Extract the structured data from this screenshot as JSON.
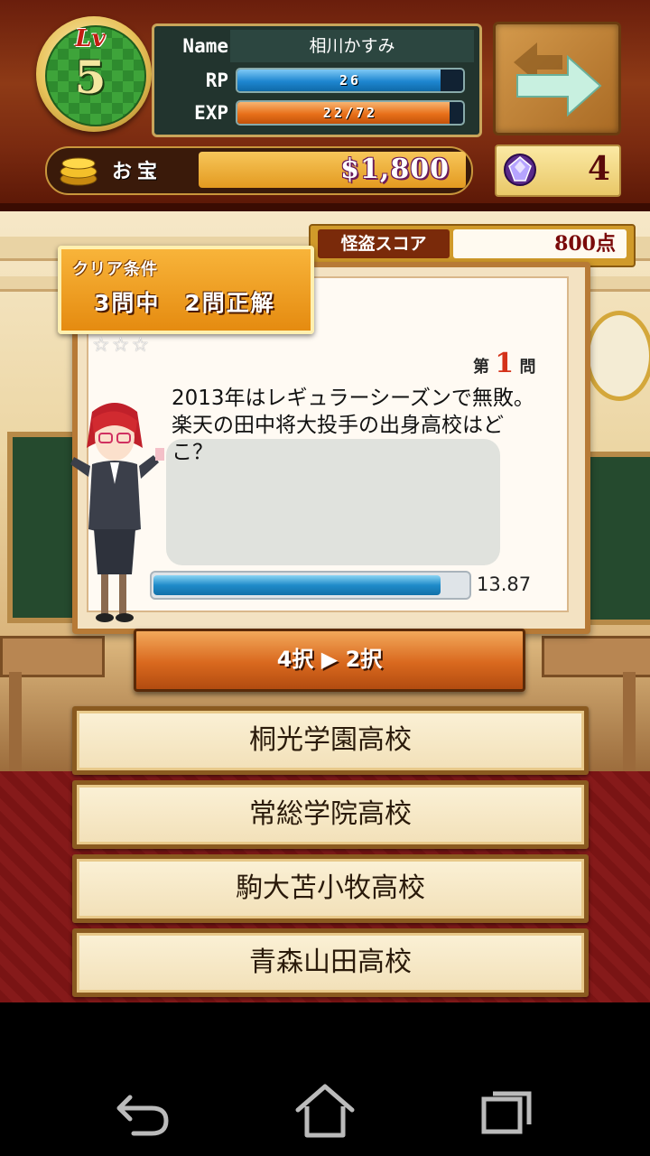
{
  "player": {
    "level_label": "Lv",
    "level": "5",
    "name_label": "Name",
    "name": "相川かすみ",
    "rp_label": "RP",
    "rp_value": "26",
    "rp_fill": 0.9,
    "exp_label": "EXP",
    "exp_value": "22/72",
    "exp_fill": 0.94
  },
  "treasure": {
    "label": "お宝",
    "value": "$1,800"
  },
  "gems": {
    "value": "4"
  },
  "score": {
    "label": "怪盗スコア",
    "value": "800点"
  },
  "clear_condition": {
    "title": "クリア条件",
    "text": "3問中　2問正解"
  },
  "question": {
    "stars": "☆☆☆",
    "round_prefix": "第",
    "round_number": "1",
    "round_suffix": "問",
    "text": "2013年はレギュラーシーズンで無敗。楽天の田中将大投手の出身高校はどこ？",
    "timer_value": "13.87",
    "timer_fill": 0.92
  },
  "narrow_button": {
    "label": "4択 ▶ 2択"
  },
  "choices": [
    {
      "label": "桐光学園高校"
    },
    {
      "label": "常総学院高校"
    },
    {
      "label": "駒大苫小牧高校"
    },
    {
      "label": "青森山田高校"
    }
  ],
  "colors": {
    "rp_bar": "#1e86d0",
    "exp_bar": "#e8701a"
  },
  "nav": {
    "icons": [
      "back-icon",
      "home-icon",
      "recent-apps-icon"
    ]
  }
}
